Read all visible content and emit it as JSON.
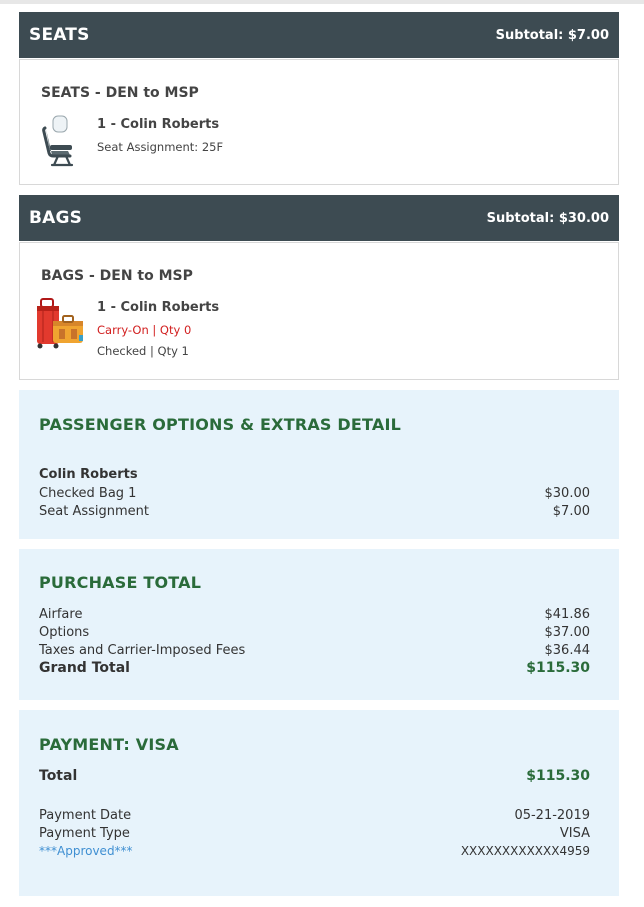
{
  "seats": {
    "header": "SEATS",
    "subtotal": "Subtotal: $7.00",
    "segment": "SEATS - DEN to MSP",
    "passenger": "1 - Colin Roberts",
    "assignment": "Seat Assignment: 25F"
  },
  "bags": {
    "header": "BAGS",
    "subtotal": "Subtotal: $30.00",
    "segment": "BAGS - DEN to MSP",
    "passenger": "1 - Colin Roberts",
    "carry_on": "Carry-On | Qty 0",
    "checked": "Checked | Qty 1"
  },
  "options_detail": {
    "title": "PASSENGER OPTIONS & EXTRAS DETAIL",
    "name": "Colin Roberts",
    "items": [
      {
        "label": "Checked Bag 1",
        "amount": "$30.00"
      },
      {
        "label": "Seat Assignment",
        "amount": "$7.00"
      }
    ]
  },
  "purchase_total": {
    "title": "PURCHASE TOTAL",
    "items": [
      {
        "label": "Airfare",
        "amount": "$41.86"
      },
      {
        "label": "Options",
        "amount": "$37.00"
      },
      {
        "label": "Taxes and Carrier-Imposed Fees",
        "amount": "$36.44"
      }
    ],
    "grand_label": "Grand Total",
    "grand_amount": "$115.30"
  },
  "payment": {
    "title": "PAYMENT: VISA",
    "total_label": "Total",
    "total_amount": "$115.30",
    "date_label": "Payment Date",
    "date_value": "05-21-2019",
    "type_label": "Payment Type",
    "type_value": "VISA",
    "approved": "***Approved***",
    "card_number": "XXXXXXXXXXXX4959"
  },
  "colors": {
    "header_bg": "#3d4b52",
    "panel_bg": "#e7f3fb",
    "accent_green": "#2a6b3a",
    "alert_red": "#d22020",
    "link_blue": "#3f8fd2"
  },
  "icons": {
    "seat": "seat-icon",
    "bags": "luggage-icon"
  }
}
